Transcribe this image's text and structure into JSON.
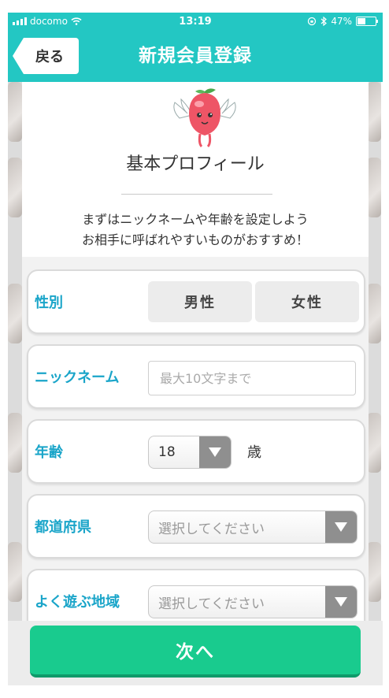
{
  "status_bar": {
    "carrier": "docomo",
    "time": "13:19",
    "battery": "47%",
    "battery_level": 0.47
  },
  "header": {
    "back_label": "戻る",
    "title": "新規会員登録"
  },
  "profile": {
    "heading": "基本プロフィール",
    "intro_line1": "まずはニックネームや年齢を設定しよう",
    "intro_line2": "お相手に呼ばれやすいものがおすすめ！"
  },
  "form": {
    "gender": {
      "label": "性別",
      "options": [
        "男性",
        "女性"
      ]
    },
    "nickname": {
      "label": "ニックネーム",
      "placeholder": "最大10文字まで"
    },
    "age": {
      "label": "年齢",
      "value": "18",
      "unit": "歳"
    },
    "prefecture": {
      "label": "都道府県",
      "value": "選択してください"
    },
    "area": {
      "label": "よく遊ぶ地域",
      "value": "選択してください"
    }
  },
  "footer": {
    "next_label": "次へ"
  },
  "colors": {
    "accent": "#23c7c3",
    "label": "#1aa5c9",
    "next_button": "#19cb8e"
  },
  "icons": [
    "signal-icon",
    "wifi-icon",
    "orientation-lock-icon",
    "bluetooth-icon",
    "battery-icon",
    "mascot-icon",
    "chevron-down-icon"
  ]
}
